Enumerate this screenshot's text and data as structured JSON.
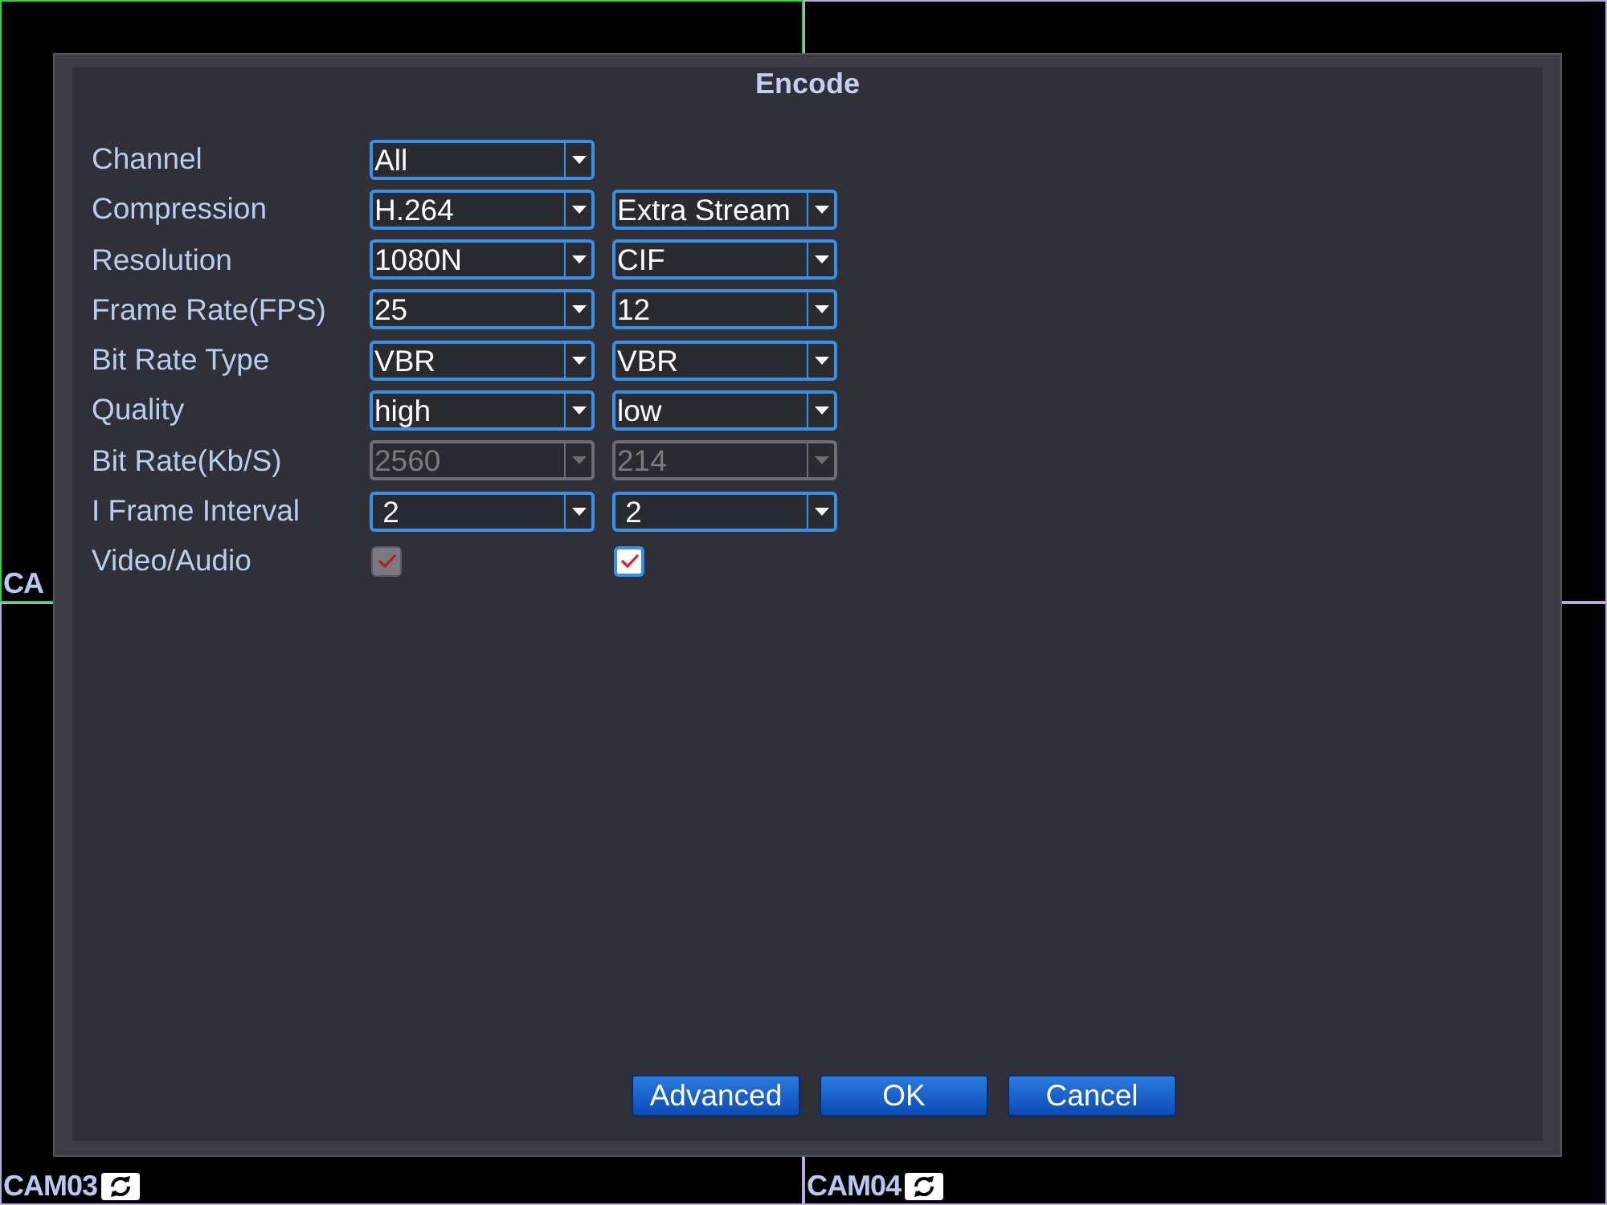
{
  "cameras": [
    {
      "label": "CA",
      "selected": true
    },
    {
      "selected": false
    },
    {
      "label": "CAM03",
      "selected": false,
      "icon": true
    },
    {
      "label": "CAM04",
      "selected": false,
      "icon": true
    }
  ],
  "dialog": {
    "title": "Encode",
    "rows": [
      {
        "label": "Channel",
        "kind": "select",
        "fields": [
          {
            "value": "All",
            "disabled": false
          }
        ]
      },
      {
        "label": "Compression",
        "kind": "select",
        "fields": [
          {
            "value": "H.264",
            "disabled": false
          },
          {
            "value": "Extra Stream",
            "disabled": false
          }
        ]
      },
      {
        "label": "Resolution",
        "kind": "select",
        "fields": [
          {
            "value": "1080N",
            "disabled": false
          },
          {
            "value": "CIF",
            "disabled": false
          }
        ]
      },
      {
        "label": "Frame Rate(FPS)",
        "kind": "select",
        "fields": [
          {
            "value": "25",
            "disabled": false
          },
          {
            "value": "12",
            "disabled": false
          }
        ]
      },
      {
        "label": "Bit Rate Type",
        "kind": "select",
        "fields": [
          {
            "value": "VBR",
            "disabled": false
          },
          {
            "value": "VBR",
            "disabled": false
          }
        ]
      },
      {
        "label": "Quality",
        "kind": "select",
        "fields": [
          {
            "value": "high",
            "disabled": false
          },
          {
            "value": "low",
            "disabled": false
          }
        ]
      },
      {
        "label": "Bit Rate(Kb/S)",
        "kind": "select",
        "fields": [
          {
            "value": "2560",
            "disabled": true
          },
          {
            "value": "214",
            "disabled": true
          }
        ]
      },
      {
        "label": "I Frame Interval",
        "kind": "select",
        "fields": [
          {
            "value": " 2",
            "disabled": false
          },
          {
            "value": " 2",
            "disabled": false
          }
        ]
      },
      {
        "label": "Video/Audio",
        "kind": "checkbox",
        "fields": [
          {
            "checked": true,
            "disabled": true
          },
          {
            "checked": true,
            "disabled": false
          }
        ]
      }
    ],
    "buttons": [
      "Advanced",
      "OK",
      "Cancel"
    ]
  }
}
